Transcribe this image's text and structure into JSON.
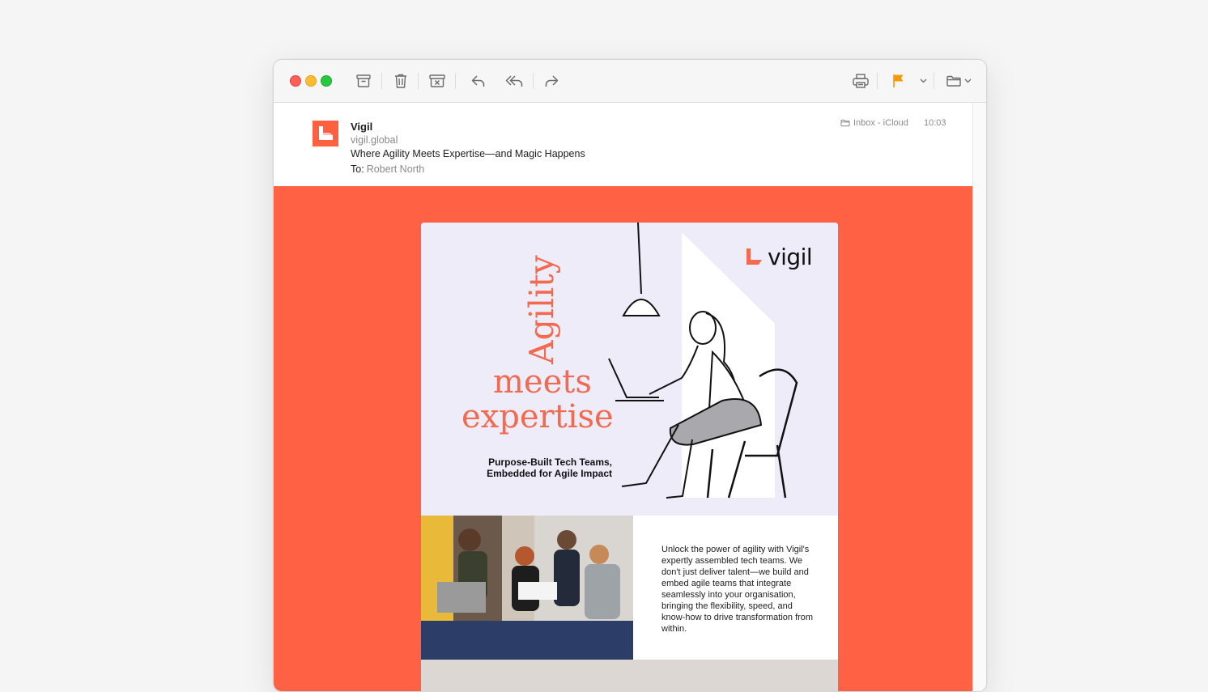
{
  "window": {
    "controls": [
      "close",
      "minimize",
      "zoom"
    ]
  },
  "toolbar": {
    "buttons": [
      {
        "name": "archive",
        "icon": "archive-box-icon"
      },
      {
        "name": "delete",
        "icon": "trash-icon"
      },
      {
        "name": "move-to-junk",
        "icon": "junk-box-icon"
      },
      {
        "name": "reply",
        "icon": "reply-arrow-icon"
      },
      {
        "name": "reply-all",
        "icon": "reply-all-arrow-icon"
      },
      {
        "name": "forward",
        "icon": "forward-arrow-icon"
      },
      {
        "name": "print",
        "icon": "printer-icon"
      },
      {
        "name": "flag",
        "icon": "flag-icon",
        "color": "#f39b0b"
      },
      {
        "name": "move-to-folder",
        "icon": "folder-icon"
      }
    ]
  },
  "email": {
    "sender_name": "Vigil",
    "sender_domain": "vigil.global",
    "subject": "Where Agility Meets Expertise—and Magic Happens",
    "to_label": "To:",
    "to_name": "Robert North",
    "mailbox": "Inbox - iCloud",
    "time": "10:03",
    "avatar_color": "#ff6140"
  },
  "newsletter": {
    "background_color": "#ff6144",
    "hero_background": "#efecfa",
    "headline_word_1": "Agility",
    "headline_word_2": "meets",
    "headline_word_3": "expertise",
    "tagline_line_1": "Purpose-Built Tech Teams,",
    "tagline_line_2": "Embedded for Agile Impact",
    "logo_text": "vigil",
    "accent_color": "#f26a4f",
    "description": "Unlock the power of agility with Vigil's expertly assembled tech teams. We don't just deliver talent—we build and embed agile teams that integrate seamlessly into your organisation, bringing the flexibility, speed, and know-how to drive transformation from within."
  }
}
